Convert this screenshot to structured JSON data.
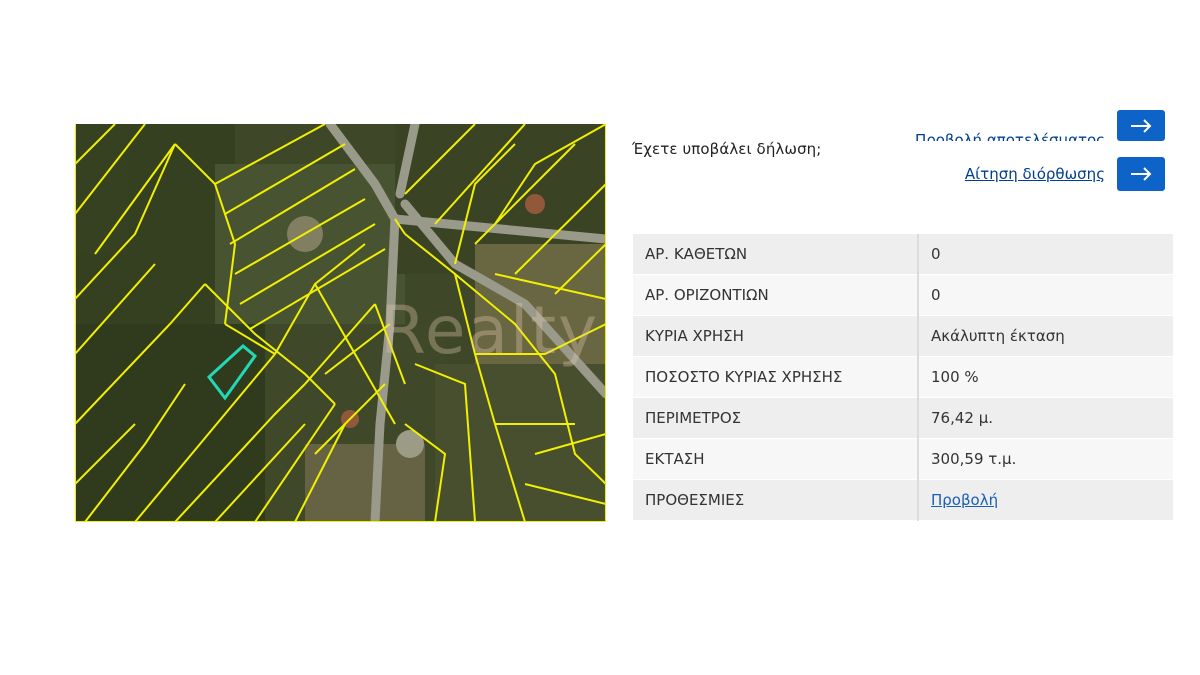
{
  "map": {
    "boundary_color": "#f1f000",
    "highlight_color": "#22d8b5"
  },
  "declaration": {
    "question": "Έχετε υποβάλει δήλωση;",
    "preview_results_label": "Προβολή αποτελέσματος",
    "correction_request_label": "Αίτηση διόρθωσης",
    "arrow_icon": "arrow-right-icon"
  },
  "details": [
    {
      "key": "ΑΡ. ΚΑΘΕΤΩΝ",
      "value": "0",
      "link": false
    },
    {
      "key": "ΑΡ. ΟΡΙΖΟΝΤΙΩΝ",
      "value": "0",
      "link": false
    },
    {
      "key": "ΚΥΡΙΑ ΧΡΗΣΗ",
      "value": "Ακάλυπτη έκταση",
      "link": false
    },
    {
      "key": "ΠΟΣΟΣΤΟ ΚΥΡΙΑΣ ΧΡΗΣΗΣ",
      "value": "100 %",
      "link": false
    },
    {
      "key": "ΠΕΡΙΜΕΤΡΟΣ",
      "value": "76,42 μ.",
      "link": false
    },
    {
      "key": "ΕΚΤΑΣΗ",
      "value": "300,59 τ.μ.",
      "link": false
    },
    {
      "key": "ΠΡΟΘΕΣΜΙΕΣ",
      "value": "Προβολή",
      "link": true
    }
  ],
  "watermark": "Realty",
  "colors": {
    "accent": "#0d63c7",
    "link": "#003f91",
    "row_odd": "#eeeeee",
    "row_even": "#f7f7f7"
  }
}
